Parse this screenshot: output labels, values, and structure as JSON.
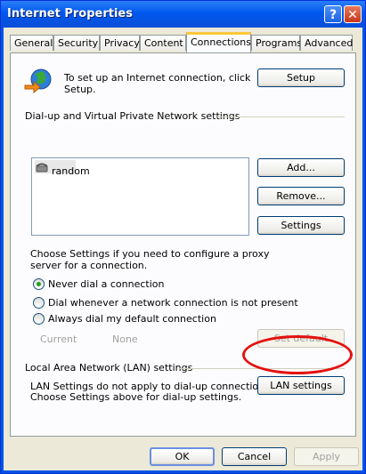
{
  "window": {
    "title": "Internet Properties",
    "help_label": "?",
    "close_label": "✕"
  },
  "tabs": [
    {
      "label": "General"
    },
    {
      "label": "Security"
    },
    {
      "label": "Privacy"
    },
    {
      "label": "Content"
    },
    {
      "label": "Connections"
    },
    {
      "label": "Programs"
    },
    {
      "label": "Advanced"
    }
  ],
  "setup": {
    "text_line1": "To set up an Internet connection, click",
    "text_line2": "Setup.",
    "button": "Setup"
  },
  "dialup": {
    "heading": "Dial-up and Virtual Private Network settings",
    "connections": [
      {
        "name": "random"
      }
    ],
    "add_button": "Add...",
    "remove_button": "Remove...",
    "settings_button": "Settings"
  },
  "proxy_text": {
    "line1": "Choose Settings if you need to configure a proxy",
    "line2": "server for a connection."
  },
  "dial_options": [
    {
      "label": "Never dial a connection",
      "checked": true
    },
    {
      "label": "Dial whenever a network connection is not present",
      "checked": false
    },
    {
      "label": "Always dial my default connection",
      "checked": false
    }
  ],
  "current": {
    "label": "Current",
    "value": "None",
    "set_default_button": "Set default"
  },
  "lan": {
    "heading": "Local Area Network (LAN) settings",
    "line1": "LAN Settings do not apply to dial-up connections.",
    "line2": "Choose Settings above for dial-up settings.",
    "button": "LAN settings"
  },
  "footer": {
    "ok": "OK",
    "cancel": "Cancel",
    "apply": "Apply"
  },
  "colors": {
    "title_bar": "#0058ee",
    "dialog_bg": "#ece9d8",
    "highlight_ring": "#e3120e",
    "active_tab_accent": "#ffc83c"
  }
}
